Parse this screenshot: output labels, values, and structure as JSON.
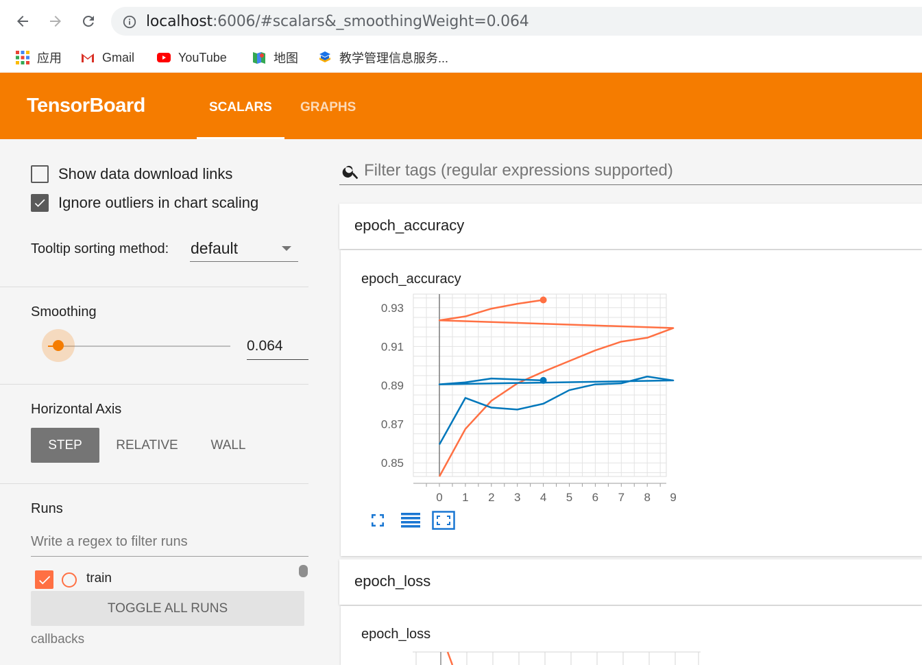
{
  "browser": {
    "url_host": "localhost",
    "url_rest": ":6006/#scalars&_smoothingWeight=0.064",
    "bookmarks": [
      "应用",
      "Gmail",
      "YouTube",
      "地图",
      "教学管理信息服务..."
    ]
  },
  "app": {
    "brand": "TensorBoard",
    "tabs": [
      "SCALARS",
      "GRAPHS"
    ],
    "active_tab": "SCALARS",
    "accent": "#f57c00"
  },
  "sidebar": {
    "show_download_links": {
      "label": "Show data download links",
      "checked": false
    },
    "ignore_outliers": {
      "label": "Ignore outliers in chart scaling",
      "checked": true
    },
    "tooltip_label": "Tooltip sorting method:",
    "tooltip_value": "default",
    "smoothing_label": "Smoothing",
    "smoothing_value": "0.064",
    "smoothing_level": 0.064,
    "horizontal_axis_label": "Horizontal Axis",
    "axis_options": [
      "STEP",
      "RELATIVE",
      "WALL"
    ],
    "axis_selected": "STEP",
    "runs_label": "Runs",
    "runs_filter_placeholder": "Write a regex to filter runs",
    "run_name": "train",
    "run_color": "#ff7043",
    "toggle_all": "TOGGLE ALL RUNS",
    "logdir": "callbacks"
  },
  "main": {
    "filter_placeholder": "Filter tags (regular expressions supported)",
    "cards": [
      {
        "header": "epoch_accuracy",
        "chart_title": "epoch_accuracy"
      },
      {
        "header": "epoch_loss",
        "chart_title": "epoch_loss"
      }
    ],
    "chart_icons": [
      "fullscreen-icon",
      "toggle-log-scale-icon",
      "fit-domain-icon"
    ]
  },
  "chart_data": {
    "type": "line",
    "title": "epoch_accuracy",
    "xlim": [
      0,
      9
    ],
    "ylim": [
      0.843,
      0.937
    ],
    "x_ticks": [
      "0",
      "1",
      "2",
      "3",
      "4",
      "5",
      "6",
      "7",
      "8",
      "9"
    ],
    "y_ticks": [
      "0.85",
      "0.87",
      "0.89",
      "0.91",
      "0.93"
    ],
    "grid": true,
    "series": [
      {
        "color": "#ff7043",
        "x": [
          0,
          1,
          2,
          3,
          4,
          5,
          6,
          7,
          8,
          9,
          0,
          1,
          2,
          3,
          4
        ],
        "y": [
          0.843,
          0.8675,
          0.882,
          0.891,
          0.897,
          0.9025,
          0.908,
          0.9125,
          0.9145,
          0.9195,
          0.9235,
          0.9255,
          0.9295,
          0.932,
          0.934
        ]
      },
      {
        "color": "#0077bb",
        "x": [
          0,
          1,
          2,
          3,
          4,
          5,
          6,
          7,
          8,
          9,
          0,
          1,
          2,
          3,
          4
        ],
        "y": [
          0.8595,
          0.8835,
          0.8785,
          0.8775,
          0.8805,
          0.8875,
          0.8905,
          0.891,
          0.8945,
          0.8925,
          0.8905,
          0.8915,
          0.8935,
          0.893,
          0.8925
        ]
      }
    ]
  }
}
